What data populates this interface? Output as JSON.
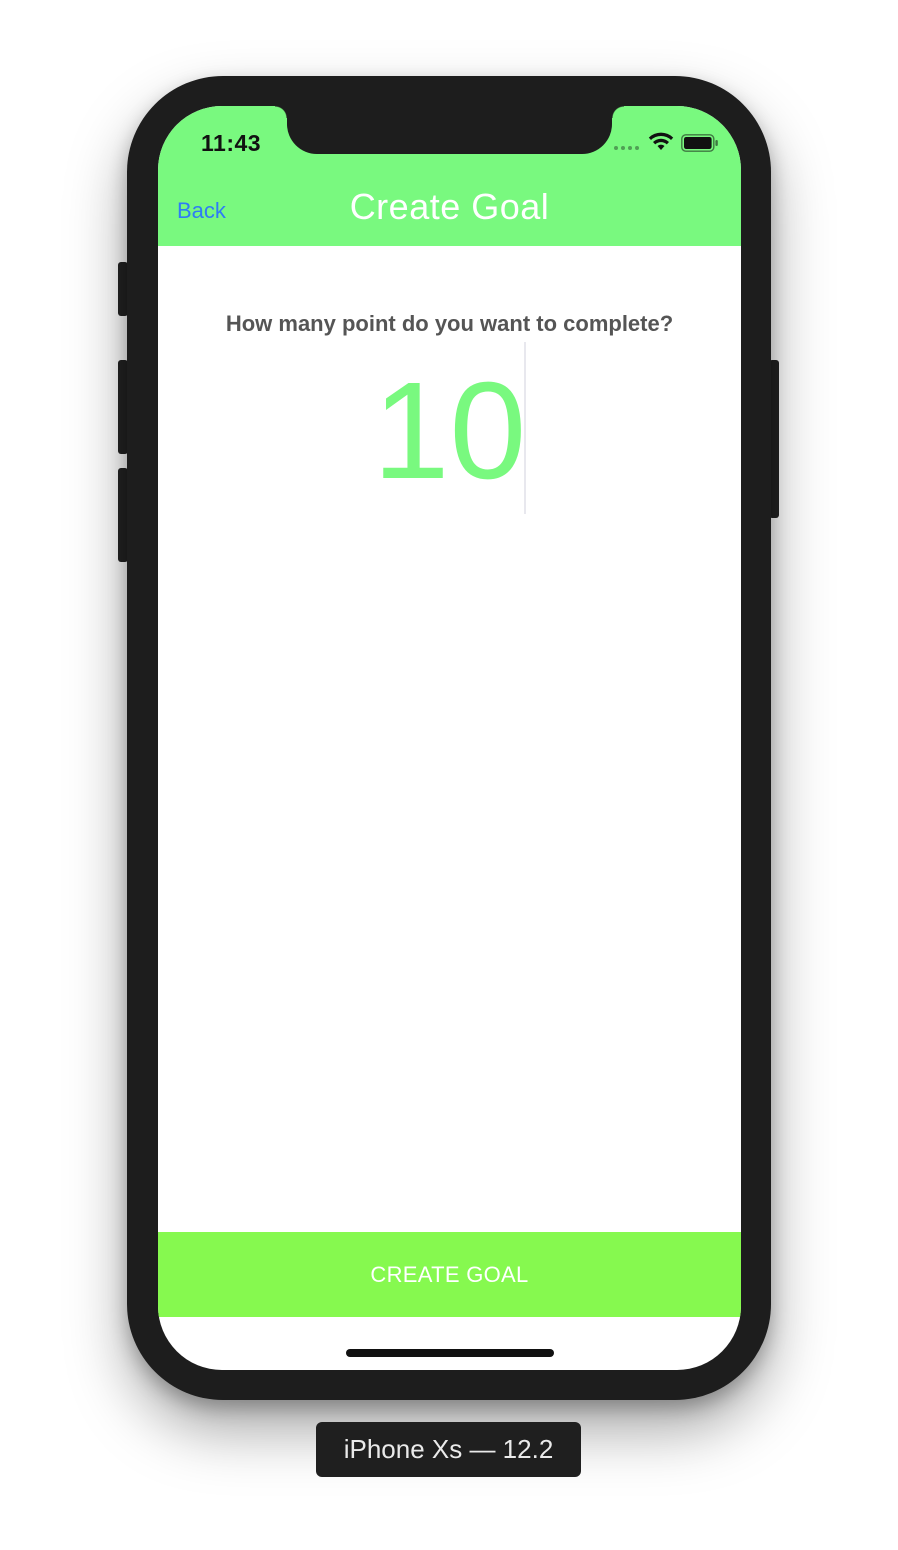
{
  "status_bar": {
    "time": "11:43",
    "icons": [
      "cellular-signal-icon",
      "wifi-icon",
      "battery-icon"
    ]
  },
  "nav": {
    "back_label": "Back",
    "title": "Create Goal"
  },
  "content": {
    "question": "How many point do you want to complete?",
    "points_value": "10"
  },
  "actions": {
    "create_label": "CREATE GOAL"
  },
  "simulator": {
    "device_label": "iPhone Xs — 12.2"
  },
  "colors": {
    "header_green": "#79f97f",
    "button_green": "#86f94f",
    "link_blue": "#2e7cf6",
    "value_green": "#79f97f"
  }
}
